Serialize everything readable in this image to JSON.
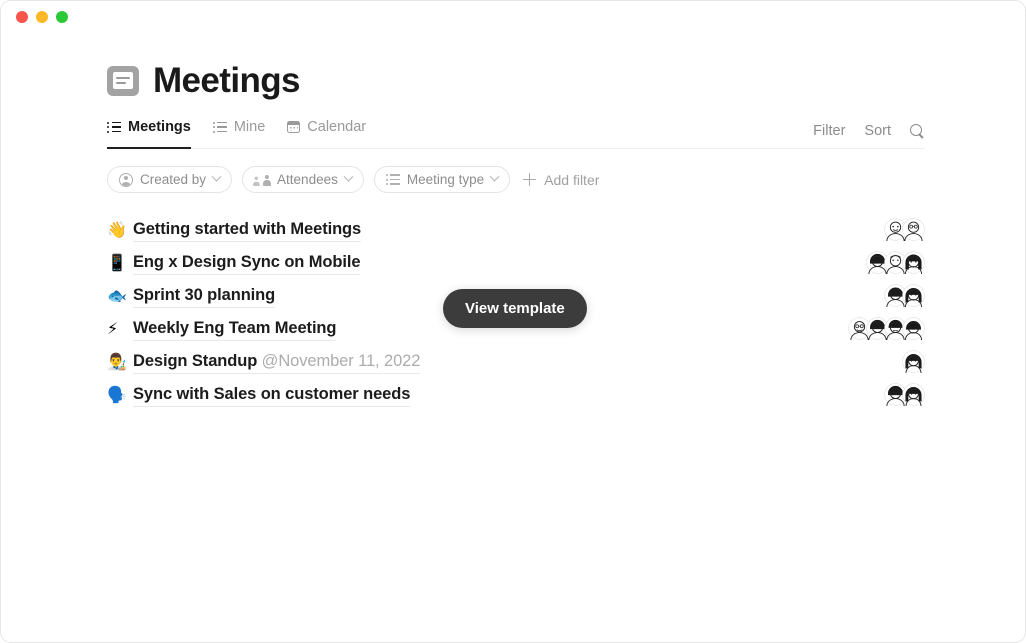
{
  "window": {
    "traffic_lights": [
      {
        "name": "close",
        "color": "#f9554d"
      },
      {
        "name": "minimize",
        "color": "#fcb827"
      },
      {
        "name": "zoom",
        "color": "#2bc937"
      }
    ]
  },
  "header": {
    "icon": "note-icon",
    "title": "Meetings"
  },
  "tabs": [
    {
      "label": "Meetings",
      "icon": "list-icon",
      "active": true
    },
    {
      "label": "Mine",
      "icon": "list-icon",
      "active": false
    },
    {
      "label": "Calendar",
      "icon": "calendar-icon",
      "active": false
    }
  ],
  "tabbar_actions": {
    "filter_label": "Filter",
    "sort_label": "Sort",
    "search_icon": "search-icon"
  },
  "filters": {
    "chips": [
      {
        "label": "Created by",
        "icon": "person-circle-icon"
      },
      {
        "label": "Attendees",
        "icon": "people-icon"
      },
      {
        "label": "Meeting type",
        "icon": "list-icon"
      }
    ],
    "add_filter_label": "Add filter",
    "add_filter_icon": "plus-icon"
  },
  "rows": [
    {
      "emoji": "👋",
      "emoji_name": "waving-hand-emoji",
      "title": "Getting started with Meetings",
      "date": "",
      "avatars": 2
    },
    {
      "emoji": "📱",
      "emoji_name": "mobile-phone-emoji",
      "title": "Eng x Design Sync on Mobile",
      "date": "",
      "avatars": 3
    },
    {
      "emoji": "🐟",
      "emoji_name": "fish-emoji",
      "title": "Sprint 30 planning",
      "date": "",
      "avatars": 2
    },
    {
      "emoji": "⚡",
      "emoji_name": "high-voltage-emoji",
      "title": "Weekly Eng Team Meeting",
      "date": "",
      "avatars": 4
    },
    {
      "emoji": "👨‍🎨",
      "emoji_name": "artist-emoji",
      "title": "Design Standup",
      "date": "@November 11, 2022",
      "avatars": 1
    },
    {
      "emoji": "🗣️",
      "emoji_name": "speaking-head-emoji",
      "title": "Sync with Sales on customer needs",
      "date": "",
      "avatars": 2
    }
  ],
  "overlay": {
    "view_template_label": "View template",
    "background_color": "#3c3c3c"
  }
}
